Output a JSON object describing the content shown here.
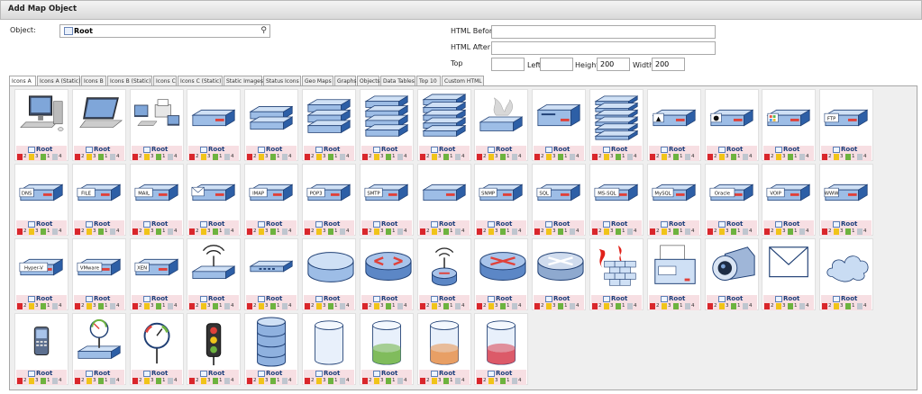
{
  "title": "Add Map Object",
  "form": {
    "object_label": "Object:",
    "object_value": "Root",
    "html_before_label": "HTML Before",
    "html_before_value": "",
    "html_after_label": "HTML After",
    "html_after_value": "",
    "top_label": "Top",
    "top_value": "",
    "left_label": "Left",
    "left_value": "",
    "height_label": "Height",
    "height_value": "200",
    "width_label": "Width",
    "width_value": "200"
  },
  "tabs": [
    "Icons A",
    "Icons A (Static)",
    "Icons B",
    "Icons B (Static)",
    "Icons C",
    "Icons C (Static)",
    "Static Images",
    "Status Icons",
    "Geo Maps",
    "Graphs",
    "Objects",
    "Data Tables",
    "Top 10",
    "Custom HTML"
  ],
  "active_tab": "Icons A",
  "tile_caption": "Root",
  "tile_counts": [
    "2",
    "3",
    "1",
    "4"
  ],
  "status_colors": [
    "#d9262b",
    "#f0c419",
    "#6db33f",
    "#bfc6cf"
  ],
  "icons": [
    {
      "kind": "desktop",
      "label": ""
    },
    {
      "kind": "laptop",
      "label": ""
    },
    {
      "kind": "workstation",
      "label": ""
    },
    {
      "kind": "server",
      "label": ""
    },
    {
      "kind": "server2",
      "label": ""
    },
    {
      "kind": "server3",
      "label": ""
    },
    {
      "kind": "server4",
      "label": ""
    },
    {
      "kind": "server5",
      "label": ""
    },
    {
      "kind": "server-hot",
      "label": ""
    },
    {
      "kind": "server-tall",
      "label": ""
    },
    {
      "kind": "rack",
      "label": ""
    },
    {
      "kind": "server",
      "label": "linux"
    },
    {
      "kind": "server",
      "label": "apple"
    },
    {
      "kind": "server",
      "label": "win"
    },
    {
      "kind": "server",
      "label": "FTP"
    },
    {
      "kind": "server",
      "label": "DNS"
    },
    {
      "kind": "server",
      "label": "FILE"
    },
    {
      "kind": "server",
      "label": "MAIL"
    },
    {
      "kind": "server",
      "label": "envelope"
    },
    {
      "kind": "server",
      "label": "IMAP"
    },
    {
      "kind": "server",
      "label": "POP3"
    },
    {
      "kind": "server",
      "label": "SMTP"
    },
    {
      "kind": "server",
      "label": ""
    },
    {
      "kind": "server",
      "label": "SNMP"
    },
    {
      "kind": "server",
      "label": "SQL"
    },
    {
      "kind": "server",
      "label": "MS-SQL"
    },
    {
      "kind": "server",
      "label": "MySQL"
    },
    {
      "kind": "server",
      "label": "Oracle"
    },
    {
      "kind": "server",
      "label": "VOIP"
    },
    {
      "kind": "server",
      "label": "WWW"
    },
    {
      "kind": "server",
      "label": "Hyper-V"
    },
    {
      "kind": "server",
      "label": "VMware"
    },
    {
      "kind": "server",
      "label": "XEN"
    },
    {
      "kind": "wifi-router",
      "label": ""
    },
    {
      "kind": "switch",
      "label": ""
    },
    {
      "kind": "disc",
      "label": ""
    },
    {
      "kind": "router",
      "label": ""
    },
    {
      "kind": "wifi-router2",
      "label": ""
    },
    {
      "kind": "router-x",
      "label": ""
    },
    {
      "kind": "router-gray",
      "label": ""
    },
    {
      "kind": "firewall",
      "label": ""
    },
    {
      "kind": "printer",
      "label": ""
    },
    {
      "kind": "camera",
      "label": ""
    },
    {
      "kind": "envelope-big",
      "label": ""
    },
    {
      "kind": "cloud",
      "label": ""
    },
    {
      "kind": "phone",
      "label": ""
    },
    {
      "kind": "gauge-base",
      "label": ""
    },
    {
      "kind": "gauge",
      "label": ""
    },
    {
      "kind": "traffic",
      "label": ""
    },
    {
      "kind": "db-stack",
      "label": ""
    },
    {
      "kind": "cyl-empty",
      "label": ""
    },
    {
      "kind": "cyl-green",
      "label": ""
    },
    {
      "kind": "cyl-orange",
      "label": ""
    },
    {
      "kind": "cyl-red",
      "label": ""
    }
  ]
}
